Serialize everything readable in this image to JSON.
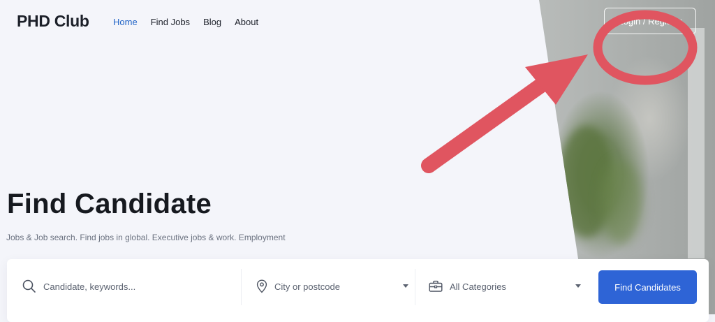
{
  "brand": {
    "logo_text": "PHD Club"
  },
  "nav": {
    "items": [
      {
        "label": "Home",
        "active": true
      },
      {
        "label": "Find Jobs"
      },
      {
        "label": "Blog"
      },
      {
        "label": "About"
      }
    ]
  },
  "header": {
    "login_label": "Login / Register"
  },
  "hero": {
    "title": "Find Candidate",
    "subtitle": "Jobs & Job search. Find jobs in global. Executive jobs & work. Employment"
  },
  "search": {
    "keyword_placeholder": "Candidate, keywords...",
    "location_placeholder": "City or postcode",
    "category_value": "All Categories",
    "submit_label": "Find Candidates"
  },
  "icons": {
    "search": "search-icon",
    "location": "map-pin-icon",
    "category": "briefcase-icon",
    "dropdown": "chevron-down-icon"
  },
  "colors": {
    "accent": "#2e64d6",
    "nav_active": "#1f63c6",
    "annotation": "#e05560",
    "background": "#f4f5fa"
  }
}
